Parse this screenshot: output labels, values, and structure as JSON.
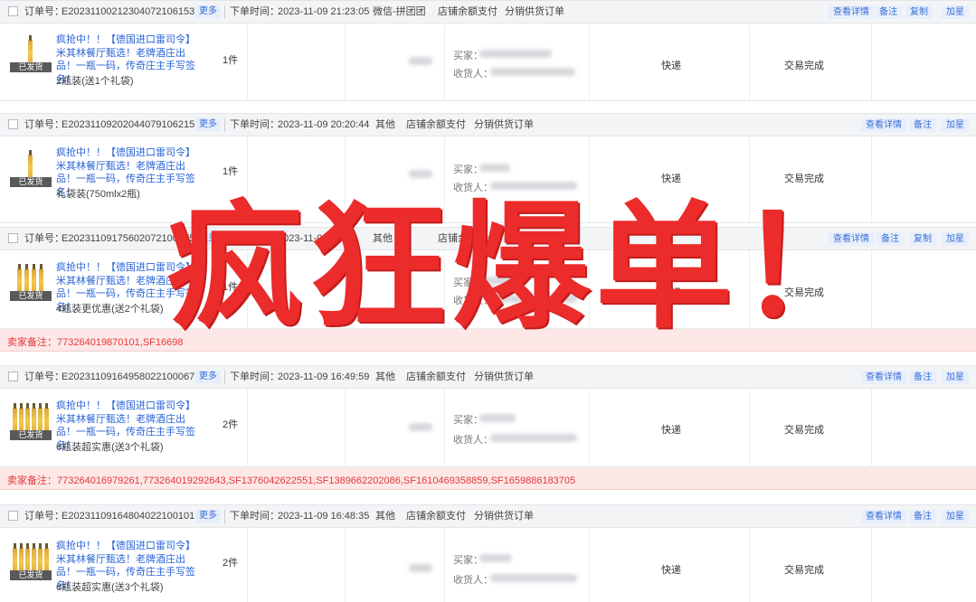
{
  "overlay_text": "疯狂爆单！",
  "labels": {
    "order_no": "订单号：",
    "more": "更多",
    "order_time": "下单时间：",
    "buyer": "买家：",
    "receiver": "收货人：",
    "shipped": "已发货",
    "seller_note": "卖家备注：",
    "delivery": "快递",
    "status_done": "交易完成"
  },
  "actions": {
    "detail": "查看详情",
    "note": "备注",
    "copy": "复制",
    "add": "加星"
  },
  "orders": [
    {
      "order_no": "E20231100212304072106153",
      "time": "2023-11-09 21:23:05",
      "source": "微信-拼团团",
      "payment": "店铺余额支付",
      "type": "分销供货订单",
      "title": "疯抢中！！【德国进口雷司令】米其林餐厅甄选！老牌酒庄出品！一瓶一码，传奇庄主手写签名！",
      "spec": "2瓶装(送1个礼袋)",
      "qty": "1件",
      "delivery": "快递",
      "status": "交易完成",
      "bottle_count": 1
    },
    {
      "order_no": "E20231109202044079106215",
      "time": "2023-11-09 20:20:44",
      "source": "其他",
      "payment": "店铺余额支付",
      "type": "分销供货订单",
      "title": "疯抢中！！【德国进口雷司令】米其林餐厅甄选！老牌酒庄出品！一瓶一码，传奇庄主手写签名！",
      "spec": "礼袋装(750mlx2瓶)",
      "qty": "1件",
      "delivery": "快递",
      "status": "交易完成",
      "bottle_count": 1
    },
    {
      "order_no": "E20231109175602072100075",
      "time": "2023-11-09",
      "source": "其他",
      "payment": "店铺余额支付",
      "type": "分销供货订单",
      "title": "疯抢中！！【德国进口雷司令】米其林餐厅甄选！老牌酒庄出品！一瓶一码，传奇庄主手写签名！",
      "spec": "4瓶装更优惠(送2个礼袋)",
      "qty": "1件",
      "delivery": "快递",
      "status": "交易完成",
      "note": "773264019870101,SF16698",
      "bottle_count": 4
    },
    {
      "order_no": "E20231109164958022100067",
      "time": "2023-11-09 16:49:59",
      "source": "其他",
      "payment": "店铺余额支付",
      "type": "分销供货订单",
      "title": "疯抢中！！【德国进口雷司令】米其林餐厅甄选！老牌酒庄出品！一瓶一码，传奇庄主手写签名！",
      "spec": "6瓶装超实惠(送3个礼袋)",
      "qty": "2件",
      "delivery": "快递",
      "status": "交易完成",
      "note": "773264016979261,773264019292643,SF1376042622551,SF1389662202086,SF1610469358859,SF1659886183705",
      "bottle_count": 6
    },
    {
      "order_no": "E20231109164804022100101",
      "time": "2023-11-09 16:48:35",
      "source": "其他",
      "payment": "店铺余额支付",
      "type": "分销供货订单",
      "title": "疯抢中！！【德国进口雷司令】米其林餐厅甄选！老牌酒庄出品！一瓶一码，传奇庄主手写签名！",
      "spec": "6瓶装超实惠(送3个礼袋)",
      "qty": "2件",
      "delivery": "快递",
      "status": "交易完成",
      "bottle_count": 6
    }
  ]
}
